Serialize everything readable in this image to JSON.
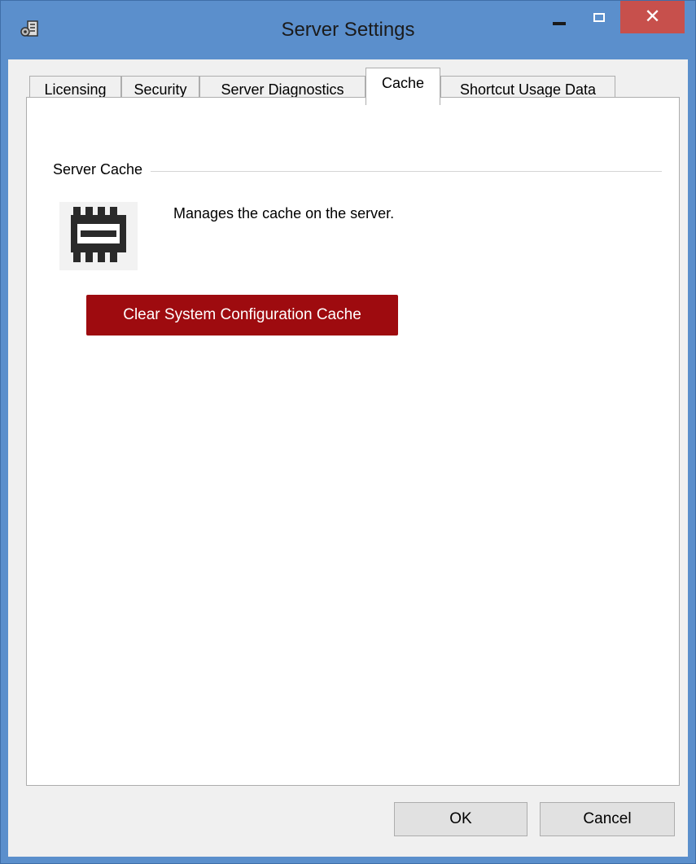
{
  "window": {
    "title": "Server Settings",
    "app_icon": "server-settings-icon",
    "colors": {
      "frame": "#5b8fcc",
      "close": "#c7504c",
      "client": "#f0f0f0"
    }
  },
  "tabs": [
    {
      "label": "Licensing",
      "active": false
    },
    {
      "label": "Security",
      "active": false
    },
    {
      "label": "Server Diagnostics",
      "active": false
    },
    {
      "label": "Cache",
      "active": true
    },
    {
      "label": "Shortcut Usage Data",
      "active": false
    }
  ],
  "cache": {
    "group_title": "Server Cache",
    "icon": "memory-chip-icon",
    "description": "Manages the cache on the server.",
    "clear_button_label": "Clear System Configuration Cache",
    "clear_button_color": "#9e0b0f"
  },
  "buttons": {
    "ok_label": "OK",
    "cancel_label": "Cancel"
  }
}
